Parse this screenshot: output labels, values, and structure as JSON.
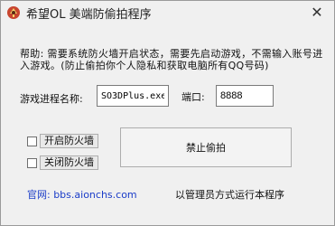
{
  "window": {
    "title": "希望OL 美端防偷拍程序",
    "close_glyph": "✕"
  },
  "help": {
    "text": "帮助: 需要系统防火墙开启状态，需要先启动游戏，不需输入账号进入游戏。(防止偷拍你个人隐私和获取电脑所有QQ号码)"
  },
  "process": {
    "label": "游戏进程名称:",
    "value": "SO3DPlus.exe"
  },
  "port": {
    "label": "端口:",
    "value": "8888"
  },
  "controls": {
    "enable_firewall": "开启防火墙",
    "disable_firewall": "关闭防火墙",
    "block_button": "禁止偷拍"
  },
  "footer": {
    "website": "官网: bbs.aionchs.com",
    "admin_note": "以管理员方式运行本程序"
  },
  "colors": {
    "link": "#1a3cc8",
    "background": "#f0f0f0"
  }
}
